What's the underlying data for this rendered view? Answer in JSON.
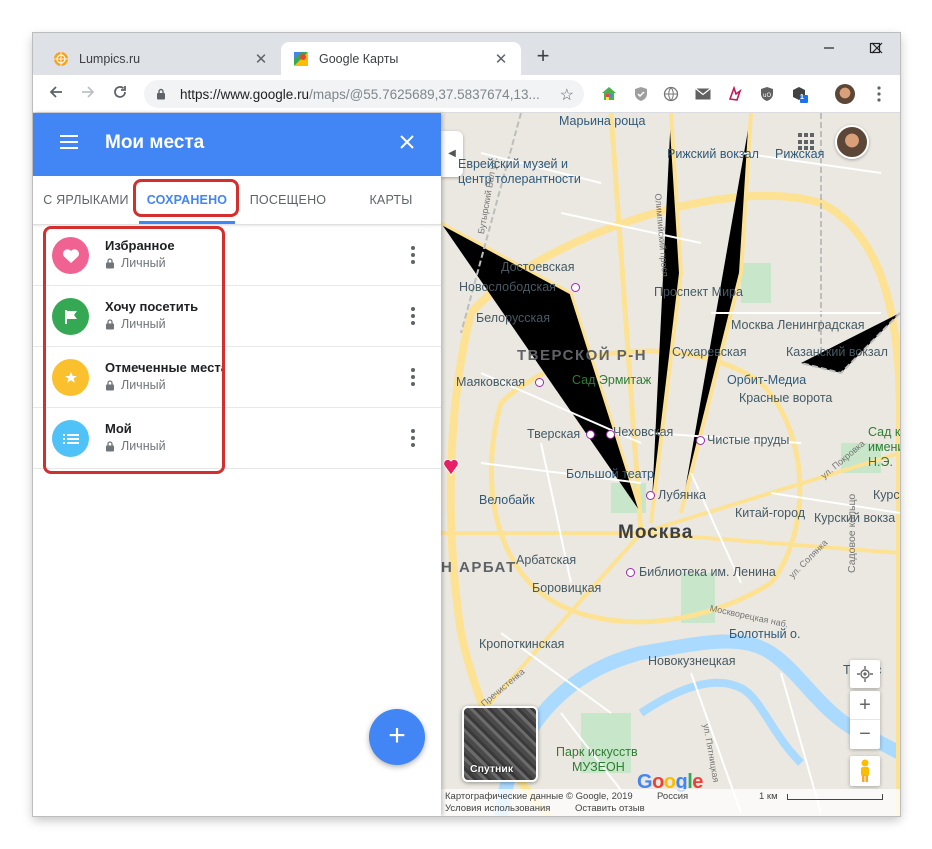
{
  "browser": {
    "tabs": [
      {
        "title": "Lumpics.ru",
        "active": false
      },
      {
        "title": "Google Карты",
        "active": true
      }
    ],
    "close_glyph": "✕",
    "new_tab_glyph": "+",
    "url_main": "https://www.google.ru",
    "url_rest": "/maps/@55.7625689,37.5837674,13...",
    "extension_badge": "1"
  },
  "panel": {
    "title": "Мои места",
    "tabs": [
      "С ЯРЛЫКАМИ",
      "СОХРАНЕНО",
      "ПОСЕЩЕНО",
      "КАРТЫ"
    ],
    "active_tab": "СОХРАНЕНО",
    "lists": [
      {
        "title": "Избранное",
        "privacy": "Личный",
        "color": "#f06292",
        "icon": "heart-icon"
      },
      {
        "title": "Хочу посетить",
        "privacy": "Личный",
        "color": "#34a853",
        "icon": "flag-icon"
      },
      {
        "title": "Отмеченные места",
        "privacy": "Личный",
        "color": "#fbc02d",
        "icon": "star-icon"
      },
      {
        "title": "Мой",
        "privacy": "Личный",
        "color": "#4fc3f7",
        "icon": "list-icon"
      }
    ],
    "fab_label": "+",
    "accent": "#4285f4",
    "highlight_color": "#d32f2f"
  },
  "map": {
    "labels": {
      "marina_roshcha": "Марьина роща",
      "museum": "Еврейский музей и",
      "museum2": "центр толерантности",
      "rizhsky": "Рижский вокзал",
      "rizhskaya": "Рижская",
      "dostoevskaya": "Достоевская",
      "novoslobodskaya": "Новослободская",
      "prospekt_mira": "Проспект Мира",
      "belorusskaya": "Белорусская",
      "moskva_len": "Москва Ленинградская",
      "tverskoy": "ТВЕРСКОЙ Р-Н",
      "sukharevskaya": "Сухаревская",
      "kazansky": "Казанский вокзал",
      "mayakovskaya": "Маяковская",
      "sad_ermitazh": "Сад Эрмитаж",
      "orbit": "Орбит-Медиа",
      "krasnye": "Красные ворота",
      "tverskaya": "Тверская",
      "chekhovskaya": "Чеховская",
      "chistye": "Чистые пруды",
      "sad_ka": "Сад к",
      "imeni": "имени",
      "ne": "Н.Э.",
      "bolshoi": "Большой театр",
      "lubyanka": "Лубянка",
      "velobike": "Велобайк",
      "kursk": "Курс",
      "kitay_gorod": "Китай-город",
      "kursky": "Курский вокза",
      "moskva": "Москва",
      "arbat": "Н АРБАТ",
      "arbatskaya": "Арбатская",
      "library": "Библиотека им. Ленина",
      "borovitskaya": "Боровицкая",
      "bolotny": "Болотный о.",
      "kropotkinskaya": "Кропоткинская",
      "novokuznetskaya": "Новокузнецкая",
      "taganskaya": "Таганс",
      "park": "Парк искусств",
      "muzeon": "МУЗЕОН",
      "sadovoe": "Садовое кольцо",
      "st1": "Бутырский Вал ул.",
      "st2": "Олимпийский просп.",
      "st3": "Москворецкая наб.",
      "st4": "ул. Покровка",
      "st5": "ул. Солянка",
      "st6": "Пречистенка",
      "st7": "ул. Пятницкая"
    },
    "satellite_label": "Спутник",
    "zoom_in": "+",
    "zoom_out": "−",
    "logo": "Google",
    "footer_data": "Картографические данные © Google, 2019",
    "footer_region": "Россия",
    "footer_scale": "1 км",
    "footer_terms": "Условия использования",
    "footer_feedback": "Оставить отзыв"
  }
}
